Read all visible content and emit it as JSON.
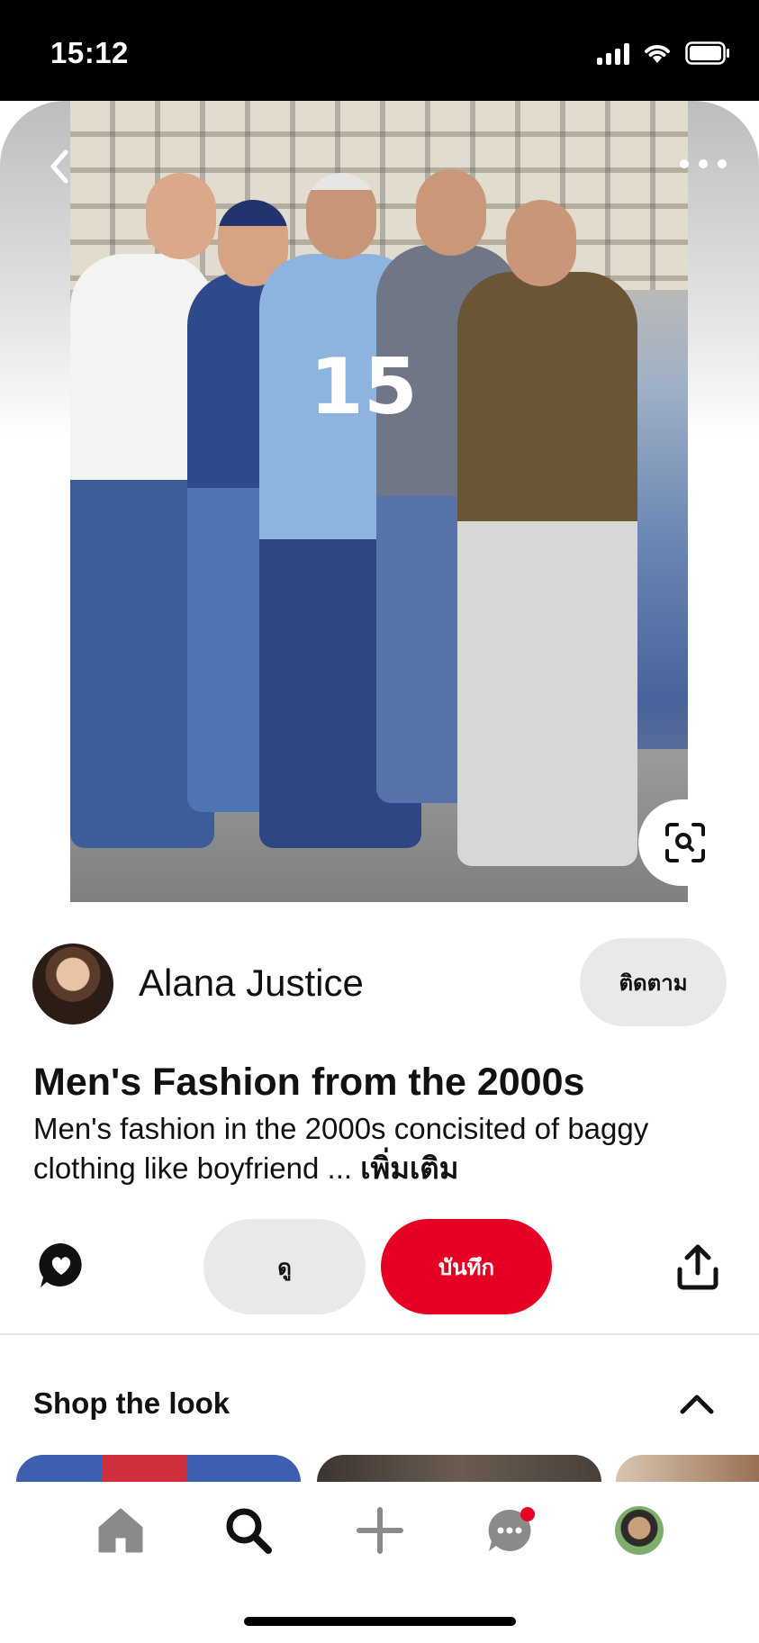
{
  "status_bar": {
    "time": "15:12"
  },
  "pin": {
    "creator_name": "Alana Justice",
    "follow_label": "ติดตาม",
    "title": "Men's Fashion from the 2000s",
    "description": "Men's fashion in the 2000s concisited of baggy clothing like boyfriend ...",
    "more_label": "เพิ่มเติม",
    "photo_jersey_number": "15"
  },
  "actions": {
    "view_label": "ดู",
    "save_label": "บันทึก"
  },
  "shop": {
    "title": "Shop the look"
  },
  "bottom_nav": {
    "items": [
      "home-icon",
      "search-icon",
      "plus-icon",
      "chat-icon",
      "profile-avatar"
    ],
    "active": "search-icon",
    "has_notification": true
  },
  "colors": {
    "accent": "#e60023",
    "pill_bg": "#e9e9e9",
    "text": "#111111"
  }
}
